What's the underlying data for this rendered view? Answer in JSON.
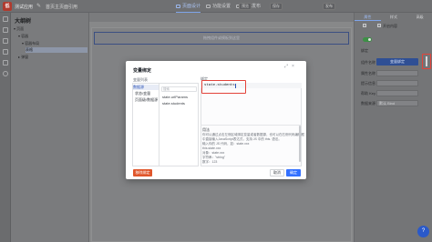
{
  "topbar": {
    "logo_text": "低",
    "app_name": "测试应用",
    "edit_glyph": "✎",
    "page_name": "首页主页面引用",
    "tabs": [
      {
        "label": "页面设计"
      },
      {
        "label": "功能设置"
      },
      {
        "label": "页面发布"
      }
    ],
    "right_buttons": [
      "预览",
      "保存",
      "发布"
    ]
  },
  "tree": {
    "title": "大纲树",
    "rows": [
      {
        "label": "▾ 页面"
      },
      {
        "label": "▾ 容器"
      },
      {
        "label": "▾ 容器布局"
      },
      {
        "label": "表格"
      },
      {
        "label": "▸ 弹窗"
      }
    ]
  },
  "canvas": {
    "toolbar_left": "",
    "placeholder": "拖拽组件或模板到这里"
  },
  "right_panel": {
    "tabs": [
      "属性",
      "样式",
      "高级"
    ],
    "check1_label": "",
    "check2_label": "开启内容",
    "section_label": "绑定",
    "field1_label": "组件名称",
    "blue_button": "变量绑定",
    "field2_label": "属性名称",
    "field3_label": "提示信息",
    "field4_label": "帮助 Key",
    "field5_label": "数据来源",
    "field5_value": "默认 Bind"
  },
  "modal": {
    "title": "变量绑定",
    "close_glyph": "×",
    "expand_glyph": "⤢",
    "list_label": "变量列表",
    "left_items": [
      "数据源",
      "状态/变量",
      "页面级/数据源"
    ],
    "search_placeholder": "搜索",
    "right_items": [
      "state.urlParams",
      "state.students"
    ],
    "code_label": "绑定",
    "code_value": "state.students",
    "help_title": "用法",
    "help_lines": [
      "你可以通过点击左侧区域绑定变量或者数据源，也可以在右侧代码编辑框",
      "中直接输入JavaScript表达式，支持 JS 中的 this. 语法。",
      "输入你的 JS 代码，如：state.xxx",
      "this.state.xxx",
      "对象：state.xxx",
      "字符串：\"string\"",
      "数字：123"
    ],
    "btn_delete": "移除绑定",
    "btn_cancel": "取消",
    "btn_ok": "确定"
  },
  "help_fab": "?",
  "colors": {
    "accent": "#3370ff",
    "danger": "#e0562b",
    "highlight": "#e3433a",
    "toggle_on": "#3d8f46"
  }
}
